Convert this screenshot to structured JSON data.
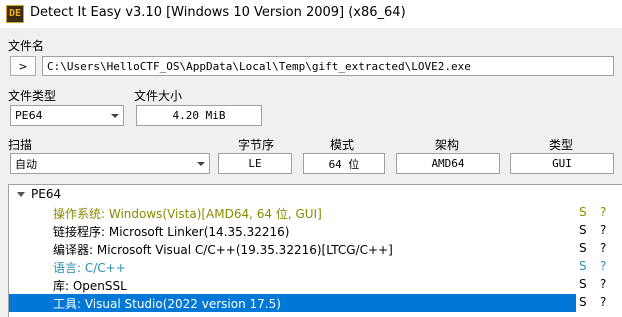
{
  "window": {
    "icon_text": "DE",
    "title": "Detect It Easy v3.10 [Windows 10 Version 2009] (x86_64)"
  },
  "file": {
    "label": "文件名",
    "browse_label": ">",
    "path": "C:\\Users\\HelloCTF_OS\\AppData\\Local\\Temp\\gift_extracted\\LOVE2.exe"
  },
  "file_type": {
    "label": "文件类型",
    "value": "PE64"
  },
  "file_size": {
    "label": "文件大小",
    "value": "4.20 MiB"
  },
  "scan": {
    "label": "扫描",
    "value": "自动"
  },
  "info": {
    "endianness": {
      "label": "字节序",
      "value": "LE"
    },
    "mode": {
      "label": "模式",
      "value": "64 位"
    },
    "arch": {
      "label": "架构",
      "value": "AMD64"
    },
    "type": {
      "label": "类型",
      "value": "GUI"
    }
  },
  "tree": {
    "root": "PE64",
    "rows": [
      {
        "text": "操作系统: Windows(Vista)[AMD64, 64 位, GUI]",
        "s": "S",
        "q": "?",
        "color": "#8a8a00"
      },
      {
        "text": "链接程序: Microsoft Linker(14.35.32216)",
        "s": "S",
        "q": "?",
        "color": "#000000"
      },
      {
        "text": "编译器: Microsoft Visual C/C++(19.35.32216)[LTCG/C++]",
        "s": "S",
        "q": "?",
        "color": "#000000"
      },
      {
        "text": "语言: C/C++",
        "s": "S",
        "q": "?",
        "color": "#2a8fb0"
      },
      {
        "text": "库: OpenSSL",
        "s": "S",
        "q": "?",
        "color": "#000000"
      },
      {
        "text": "工具: Visual Studio(2022 version 17.5)",
        "s": "S",
        "q": "?",
        "color": "#000000"
      }
    ]
  }
}
